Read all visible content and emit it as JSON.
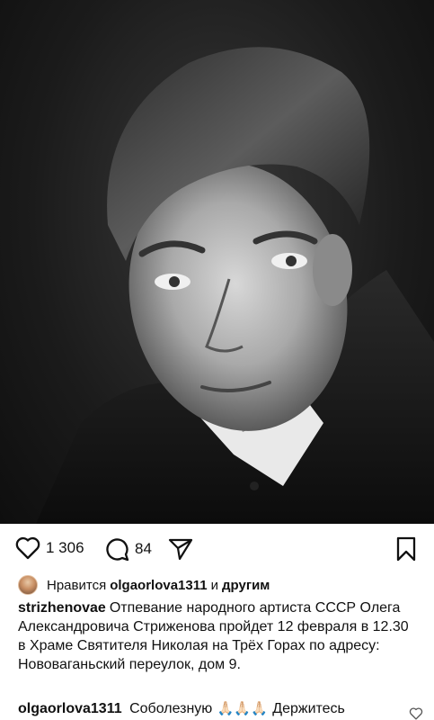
{
  "post": {
    "photo_label": "black-and-white portrait",
    "likes_count": "1 306",
    "comments_count": "84"
  },
  "liked_by": {
    "prefix": "Нравится",
    "user": "olgaorlova1311",
    "connector": "и",
    "others": "другим"
  },
  "caption": {
    "user": "strizhenovae",
    "text_1": "Отпевание народного артиста СССР Олега Александровича Стриженова пройдет 12 февраля в 12.30",
    "text_2": "в Храме Святителя Николая на Трёх Горах по адресу: Нововаганьский переулок, дом 9."
  },
  "comment": {
    "user": "olgaorlova1311",
    "text": "Соболезную",
    "emoji": "🙏🏻🙏🏻🙏🏻",
    "tail": "Держитесь"
  },
  "icons": {
    "like": "heart-icon",
    "comment": "comment-icon",
    "share": "send-icon",
    "save": "bookmark-icon"
  }
}
